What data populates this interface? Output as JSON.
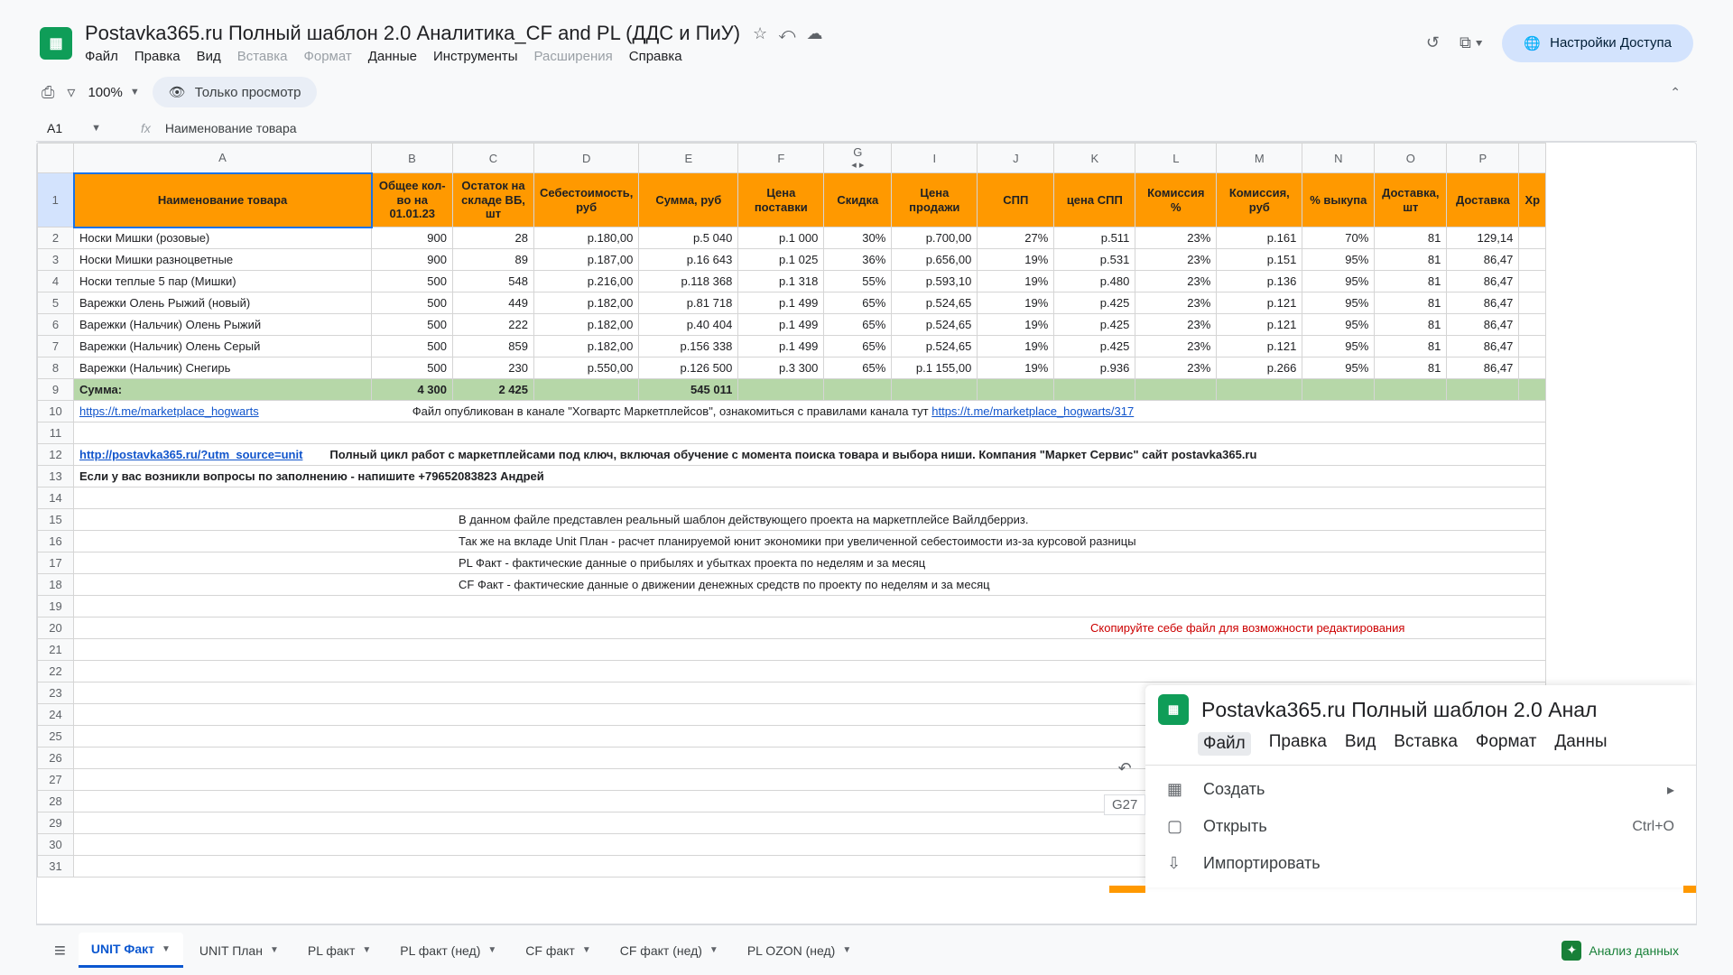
{
  "doc": {
    "title": "Postavka365.ru Полный шаблон 2.0 Аналитика_CF and PL (ДДС и ПиУ)",
    "history_icon": "history",
    "meet_icon": "camera"
  },
  "menus": [
    "Файл",
    "Правка",
    "Вид",
    "Вставка",
    "Формат",
    "Данные",
    "Инструменты",
    "Расширения",
    "Справка"
  ],
  "menus_disabled": [
    3,
    4,
    7
  ],
  "share_label": "Настройки Доступа",
  "toolbar": {
    "zoom": "100%",
    "viewonly": "Только просмотр"
  },
  "namebox": "A1",
  "fx_value": "Наименование товара",
  "columns": [
    "A",
    "B",
    "C",
    "D",
    "E",
    "F",
    "G",
    "I",
    "J",
    "K",
    "L",
    "M",
    "N",
    "O",
    "P"
  ],
  "col_group_between": "G_I",
  "headers": [
    "Наименование товара",
    "Общее кол-во на 01.01.23",
    "Остаток на складе ВБ, шт",
    "Себестоимость, руб",
    "Сумма, руб",
    "Цена поставки",
    "Скидка",
    "Цена продажи",
    "СПП",
    "цена СПП",
    "Комиссия %",
    "Комиссия, руб",
    "% выкупа",
    "Доставка, шт",
    "Доставка"
  ],
  "last_header_cut": "Хр",
  "rows": [
    {
      "n": "2",
      "c": [
        "Носки Мишки (розовые)",
        "900",
        "28",
        "р.180,00",
        "р.5 040",
        "р.1 000",
        "30%",
        "р.700,00",
        "27%",
        "р.511",
        "23%",
        "р.161",
        "70%",
        "81",
        "129,14"
      ]
    },
    {
      "n": "3",
      "c": [
        "Носки Мишки разноцветные",
        "900",
        "89",
        "р.187,00",
        "р.16 643",
        "р.1 025",
        "36%",
        "р.656,00",
        "19%",
        "р.531",
        "23%",
        "р.151",
        "95%",
        "81",
        "86,47"
      ]
    },
    {
      "n": "4",
      "c": [
        "Носки теплые 5 пар (Мишки)",
        "500",
        "548",
        "р.216,00",
        "р.118 368",
        "р.1 318",
        "55%",
        "р.593,10",
        "19%",
        "р.480",
        "23%",
        "р.136",
        "95%",
        "81",
        "86,47"
      ]
    },
    {
      "n": "5",
      "c": [
        "Варежки Олень Рыжий (новый)",
        "500",
        "449",
        "р.182,00",
        "р.81 718",
        "р.1 499",
        "65%",
        "р.524,65",
        "19%",
        "р.425",
        "23%",
        "р.121",
        "95%",
        "81",
        "86,47"
      ]
    },
    {
      "n": "6",
      "c": [
        "Варежки (Нальчик) Олень Рыжий",
        "500",
        "222",
        "р.182,00",
        "р.40 404",
        "р.1 499",
        "65%",
        "р.524,65",
        "19%",
        "р.425",
        "23%",
        "р.121",
        "95%",
        "81",
        "86,47"
      ]
    },
    {
      "n": "7",
      "c": [
        "Варежки (Нальчик) Олень Серый",
        "500",
        "859",
        "р.182,00",
        "р.156 338",
        "р.1 499",
        "65%",
        "р.524,65",
        "19%",
        "р.425",
        "23%",
        "р.121",
        "95%",
        "81",
        "86,47"
      ]
    },
    {
      "n": "8",
      "c": [
        "Варежки (Нальчик) Снегирь",
        "500",
        "230",
        "р.550,00",
        "р.126 500",
        "р.3 300",
        "65%",
        "р.1 155,00",
        "19%",
        "р.936",
        "23%",
        "р.266",
        "95%",
        "81",
        "86,47"
      ]
    }
  ],
  "sum_row": {
    "n": "9",
    "label": "Сумма:",
    "b": "4 300",
    "c": "2 425",
    "e": "545 011"
  },
  "row10": {
    "n": "10",
    "link": "https://t.me/marketplace_hogwarts",
    "text_prefix": "Файл опубликован в канале \"Хогвартс Маркетплейсов\", ознакомиться с правилами канала тут ",
    "link2": "https://t.me/marketplace_hogwarts/317"
  },
  "row12": {
    "n": "12",
    "link": "http://postavka365.ru/?utm_source=unit",
    "text": "Полный цикл работ с маркетплейсами под ключ, включая обучение с момента поиска товара и выбора ниши. Компания \"Маркет Сервис\" сайт postavka365.ru"
  },
  "row13": {
    "n": "13",
    "text": "Если у вас возникли вопросы по заполнению - напишите +79652083823 Андрей"
  },
  "row15": {
    "n": "15",
    "text": "В данном файле представлен реальный шаблон действующего проекта на маркетплейсе Вайлдберриз."
  },
  "row16": {
    "n": "16",
    "text": "Так же на вкладе Unit План - расчет планируемой юнит экономики при увеличенной себестоимости из-за курсовой разницы"
  },
  "row17": {
    "n": "17",
    "text": "PL Факт - фактические данные о прибылях и убытках проекта по неделям и за месяц"
  },
  "row18": {
    "n": "18",
    "text": "CF Факт - фактические  данные о движении денежных средств по проекту по неделям и за месяц"
  },
  "row20": {
    "n": "20",
    "text": "Скопируйте себе файл для возможности редактирования"
  },
  "empty_rows": [
    "11",
    "14",
    "19",
    "21",
    "22",
    "23",
    "24",
    "25",
    "26",
    "27",
    "28",
    "29",
    "30",
    "31"
  ],
  "tabs": [
    "UNIT Факт",
    "UNIT План",
    "PL факт",
    "PL факт (нед)",
    "CF факт",
    "CF факт (нед)",
    "PL OZON (нед)"
  ],
  "active_tab": 0,
  "analyze_label": "Анализ данных",
  "overlay": {
    "title": "Postavka365.ru Полный шаблон 2.0 Анал",
    "menus": [
      "Файл",
      "Правка",
      "Вид",
      "Вставка",
      "Формат",
      "Данны"
    ],
    "cellref": "G27",
    "items": [
      {
        "icon": "▦",
        "label": "Создать",
        "shortcut": "▸"
      },
      {
        "icon": "▢",
        "label": "Открыть",
        "shortcut": "Ctrl+O"
      },
      {
        "icon": "⇩",
        "label": "Импортировать",
        "shortcut": ""
      }
    ]
  }
}
